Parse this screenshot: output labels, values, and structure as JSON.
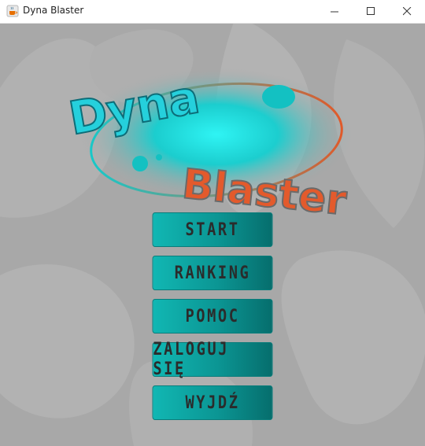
{
  "window": {
    "title": "Dyna Blaster"
  },
  "logo": {
    "line1": "Dyna",
    "line2": "Blaster"
  },
  "menu": [
    {
      "label": "START"
    },
    {
      "label": "RANKING"
    },
    {
      "label": "POMOC"
    },
    {
      "label": "ZALOGUJ SIĘ"
    },
    {
      "label": "WYJDŹ"
    }
  ],
  "colors": {
    "background": "#a8a8a8",
    "button": "#0b9593",
    "logo_cyan": "#1ec8d4",
    "logo_orange": "#e05a2a",
    "logo_gray": "#8a8a8a"
  },
  "icons": {
    "app": "java-cup-icon"
  }
}
